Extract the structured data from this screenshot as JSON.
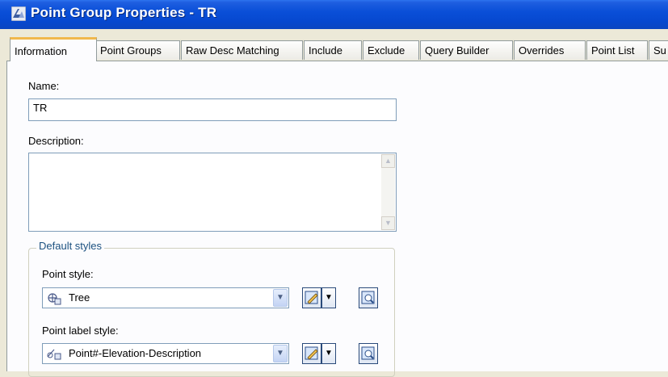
{
  "window": {
    "title": "Point Group Properties - TR"
  },
  "tabs": [
    {
      "label": "Information"
    },
    {
      "label": "Point Groups"
    },
    {
      "label": "Raw Desc Matching"
    },
    {
      "label": "Include"
    },
    {
      "label": "Exclude"
    },
    {
      "label": "Query Builder"
    },
    {
      "label": "Overrides"
    },
    {
      "label": "Point List"
    },
    {
      "label": "Su"
    }
  ],
  "form": {
    "name_label": "Name:",
    "name_value": "TR",
    "description_label": "Description:",
    "description_value": ""
  },
  "default_styles": {
    "legend": "Default styles",
    "point_style_label": "Point style:",
    "point_style_value": "Tree",
    "point_label_style_label": "Point label style:",
    "point_label_style_value": "Point#-Elevation-Description"
  },
  "icons": {
    "title": "app-logo-icon",
    "point_style": "tree-point-style-icon",
    "label_style": "point-label-style-icon",
    "edit": "edit-style-icon",
    "preview": "preview-style-icon"
  },
  "colors": {
    "titlebar": "#0a4fd8",
    "active_tab_accent": "#f1b84c",
    "group_legend": "#1c5180"
  }
}
